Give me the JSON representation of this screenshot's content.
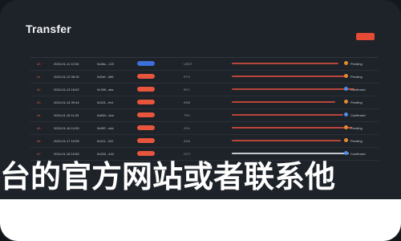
{
  "window": {
    "title": "Transfer"
  },
  "table": {
    "rows": [
      {
        "id": "#0",
        "date": "2024-01-11 12:34",
        "name": "0xAbc...123",
        "pill": "blue",
        "mini": "USDT",
        "bar": 0.78,
        "bar_style": "red",
        "status": "Pending",
        "dot": "orange"
      },
      {
        "id": "#1",
        "date": "2024-01-12 08:15",
        "name": "0xDef...456",
        "pill": "red",
        "mini": "ETH",
        "bar": 0.84,
        "bar_style": "red",
        "status": "Pending",
        "dot": "orange"
      },
      {
        "id": "#2",
        "date": "2024-01-13 16:02",
        "name": "0x789...abc",
        "pill": "red",
        "mini": "BTC",
        "bar": 0.9,
        "bar_style": "red",
        "status": "Confirmed",
        "dot": "blue"
      },
      {
        "id": "#3",
        "date": "2024-01-14 09:44",
        "name": "0x321...fed",
        "pill": "red",
        "mini": "BNB",
        "bar": 0.76,
        "bar_style": "red",
        "status": "Pending",
        "dot": "orange"
      },
      {
        "id": "#4",
        "date": "2024-01-15 11:20",
        "name": "0x654...cba",
        "pill": "red",
        "mini": "TRX",
        "bar": 0.82,
        "bar_style": "red",
        "status": "Confirmed",
        "dot": "blue"
      },
      {
        "id": "#5",
        "date": "2024-01-16 14:30",
        "name": "0x987...dcb",
        "pill": "red",
        "mini": "SOL",
        "bar": 0.88,
        "bar_style": "red",
        "status": "Pending",
        "dot": "orange"
      },
      {
        "id": "#6",
        "date": "2024-01-17 10:05",
        "name": "0x111...222",
        "pill": "red",
        "mini": "ADA",
        "bar": 0.8,
        "bar_style": "red",
        "status": "Pending",
        "dot": "orange"
      },
      {
        "id": "#7",
        "date": "2024-01-18 19:55",
        "name": "0x333...444",
        "pill": "red",
        "mini": "DOT",
        "bar": 0.86,
        "bar_style": "light",
        "status": "Confirmed",
        "dot": "blue"
      }
    ]
  },
  "overlay_text": "台的官方网站或者联系他"
}
